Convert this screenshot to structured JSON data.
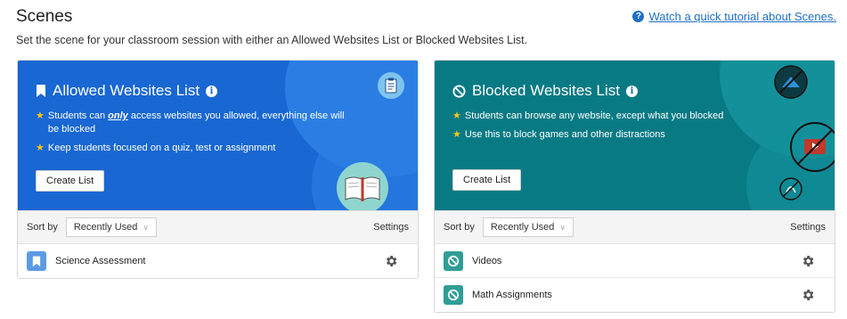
{
  "header": {
    "title": "Scenes",
    "tutorial_link": "Watch a quick tutorial about Scenes.",
    "subtitle": "Set the scene for your classroom session with either an Allowed Websites List or Blocked Websites List."
  },
  "allowed": {
    "title": "Allowed Websites List",
    "features": [
      {
        "pre": "Students can ",
        "em": "only",
        "post": " access websites you allowed, everything else will be blocked"
      },
      {
        "pre": "Keep students focused on a quiz, test or assignment",
        "em": "",
        "post": ""
      }
    ],
    "create_label": "Create List",
    "sort_label": "Sort by",
    "sort_value": "Recently Used",
    "settings_label": "Settings",
    "items": [
      {
        "label": "Science Assessment"
      }
    ]
  },
  "blocked": {
    "title": "Blocked Websites List",
    "features": [
      {
        "pre": "Students can browse any website, except what you blocked"
      },
      {
        "pre": "Use this to block games and other distractions"
      }
    ],
    "create_label": "Create List",
    "sort_label": "Sort by",
    "sort_value": "Recently Used",
    "settings_label": "Settings",
    "items": [
      {
        "label": "Videos"
      },
      {
        "label": "Math Assignments"
      }
    ]
  },
  "colors": {
    "allowed_bg": "#1867d2",
    "blocked_bg": "#087a84",
    "link": "#1f6fc4",
    "star": "#f5c518"
  }
}
